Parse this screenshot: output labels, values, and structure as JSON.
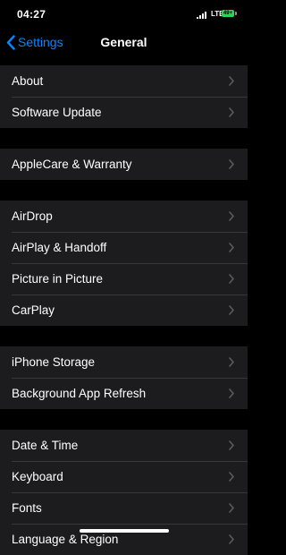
{
  "status_bar": {
    "time": "04:27",
    "network": "LTE",
    "battery": "49+",
    "battery_color": "#30d158"
  },
  "nav": {
    "back_label": "Settings",
    "back_icon": "chevron-left-icon",
    "title": "General",
    "accent_color": "#0a84ff"
  },
  "groups": [
    {
      "items": [
        {
          "label": "About"
        },
        {
          "label": "Software Update"
        }
      ]
    },
    {
      "items": [
        {
          "label": "AppleCare & Warranty"
        }
      ]
    },
    {
      "items": [
        {
          "label": "AirDrop"
        },
        {
          "label": "AirPlay & Handoff"
        },
        {
          "label": "Picture in Picture"
        },
        {
          "label": "CarPlay"
        }
      ]
    },
    {
      "items": [
        {
          "label": "iPhone Storage"
        },
        {
          "label": "Background App Refresh"
        }
      ]
    },
    {
      "items": [
        {
          "label": "Date & Time"
        },
        {
          "label": "Keyboard"
        },
        {
          "label": "Fonts"
        },
        {
          "label": "Language & Region"
        }
      ]
    }
  ],
  "row_icon": "chevron-right-icon"
}
